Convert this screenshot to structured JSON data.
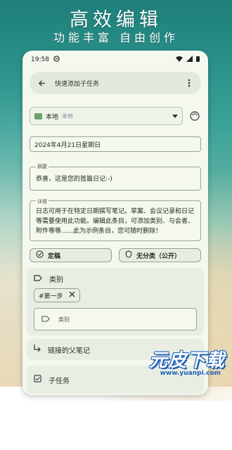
{
  "promo": {
    "headline": "高效编辑",
    "subline": "功能丰富  自由创作"
  },
  "status": {
    "time": "19:58"
  },
  "search": {
    "placeholder": "快速添加子任务"
  },
  "notebook": {
    "name": "本地",
    "sub": "本地"
  },
  "date": {
    "value": "2024年4月21日星期日"
  },
  "summary": {
    "legend": "摘要",
    "value": "恭喜，这是您的首篇日记:-)"
  },
  "details": {
    "legend": "详情",
    "value": "日志可用于在特定日期撰写笔记。草案、会议记录和日记等需要使用此功能。编辑此条目，可添加类别、与会者、附件等等......此为示例条目，您可随时删除！"
  },
  "chips": {
    "status": "定稿",
    "classification": "无分类（公开）"
  },
  "category": {
    "title": "类别",
    "tag": "#第一步",
    "input_placeholder": "类别"
  },
  "parent": {
    "label": "链接的父笔记"
  },
  "subtasks": {
    "label": "子任务"
  },
  "watermark": {
    "main": "元皮下载",
    "url": "www.yuanpi.com"
  },
  "colors": {
    "accent": "#6da06a",
    "surface": "#f4f8ee",
    "section": "#e9eee4"
  }
}
